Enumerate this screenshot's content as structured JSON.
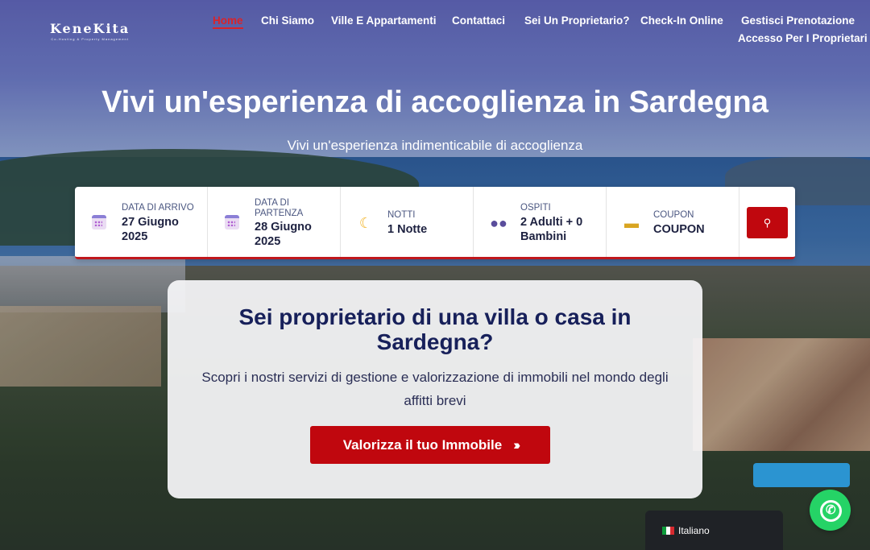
{
  "header": {
    "logo_text": "KeneKita",
    "logo_tagline": "Co-Hosting & Property Management",
    "nav": [
      {
        "label": "Home"
      },
      {
        "label": "Chi Siamo"
      },
      {
        "label": "Ville E Appartamenti"
      },
      {
        "label": "Contattaci"
      },
      {
        "label": "Sei Un Proprietario?"
      },
      {
        "label": "Check-In Online"
      },
      {
        "label": "Gestisci Prenotazione"
      },
      {
        "label": "Accesso Per I Proprietari"
      }
    ]
  },
  "hero": {
    "title": "Vivi un'esperienza di accoglienza in Sardegna",
    "subtitle": "Vivi un'esperienza indimenticabile di accoglienza"
  },
  "booking": {
    "checkin": {
      "label": "DATA DI ARRIVO",
      "value": "27 Giugno 2025",
      "icon": "calendar-icon"
    },
    "checkout": {
      "label": "DATA DI PARTENZA",
      "value": "28 Giugno 2025",
      "icon": "calendar-icon"
    },
    "nights": {
      "label": "NOTTI",
      "value": "1 Notte",
      "icon": "moon-icon"
    },
    "guests": {
      "label": "OSPITI",
      "value": "2 Adulti + 0 Bambini",
      "icon": "people-icon"
    },
    "coupon": {
      "label": "COUPON",
      "value": "COUPON",
      "icon": "ticket-icon"
    },
    "search_icon": "location-pin-icon"
  },
  "owner_card": {
    "title": "Sei proprietario di una villa o casa in Sardegna?",
    "text": "Scopri i nostri servizi di gestione e valorizzazione di immobili nel mondo degli affitti brevi",
    "cta_label": "Valorizza il tuo Immobile"
  },
  "language": {
    "label": "Italiano",
    "flag": "italy-flag"
  },
  "colors": {
    "accent": "#c0070e",
    "title": "#17205a"
  }
}
